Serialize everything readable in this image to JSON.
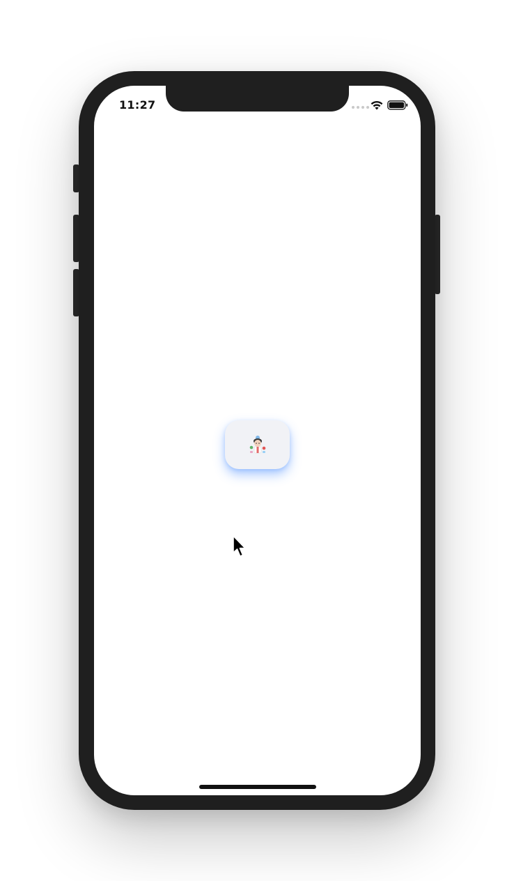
{
  "status_bar": {
    "time": "11:27",
    "icons": [
      "signal-dots-icon",
      "wifi-icon",
      "battery-icon"
    ]
  },
  "app_tile": {
    "icon": "cartoon-character-icon",
    "glow_color": "#468cff",
    "background": "#f1f2f6"
  },
  "pointer": {
    "icon": "mouse-cursor-icon"
  }
}
